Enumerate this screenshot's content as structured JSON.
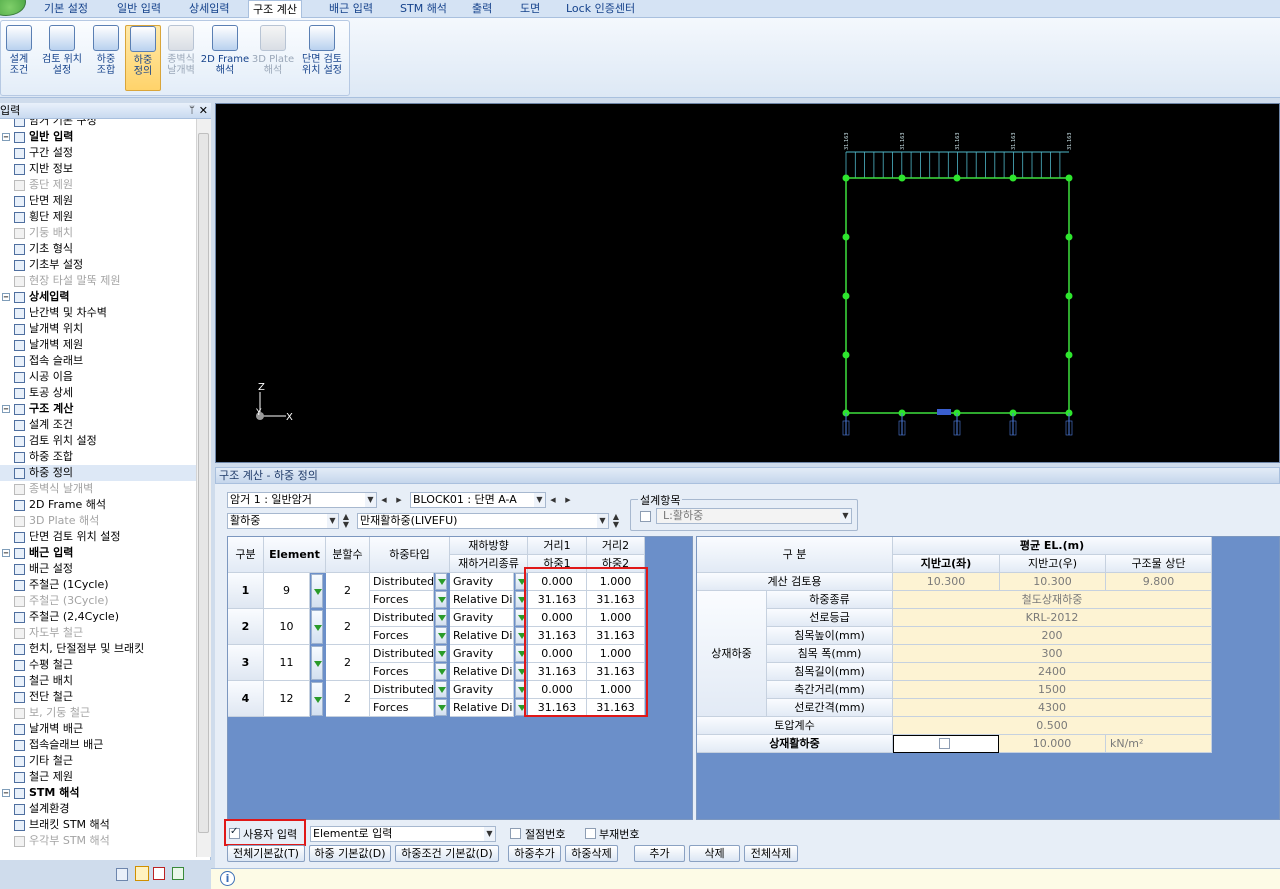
{
  "ribbon": {
    "tabs": [
      "기본 설정",
      "일반 입력",
      "상세입력",
      "구조 계산",
      "배근 입력",
      "STM 해석",
      "출력",
      "도면",
      "Lock 인증센터"
    ],
    "active_tab": "구조 계산",
    "buttons": [
      {
        "l1": "설계",
        "l2": "조건",
        "icon": "design-condition-icon",
        "state": "normal"
      },
      {
        "l1": "검토 위치",
        "l2": "설정",
        "icon": "review-location-icon",
        "state": "normal"
      },
      {
        "l1": "하중",
        "l2": "조합",
        "icon": "load-combination-icon",
        "state": "normal"
      },
      {
        "l1": "하중",
        "l2": "정의",
        "icon": "load-definition-icon",
        "state": "selected"
      },
      {
        "l1": "종벽식",
        "l2": "날개벽",
        "icon": "wing-wall-icon",
        "state": "disabled"
      },
      {
        "l1": "2D Frame",
        "l2": "해석",
        "icon": "frame-2d-icon",
        "state": "normal"
      },
      {
        "l1": "3D Plate",
        "l2": "해석",
        "icon": "plate-3d-icon",
        "state": "disabled"
      },
      {
        "l1": "단면 검토",
        "l2": "위치 설정",
        "icon": "section-review-icon",
        "state": "normal"
      }
    ]
  },
  "left_panel": {
    "title": "입력",
    "pin": "ᛘ",
    "close": "✕",
    "tree": [
      {
        "label": "암거 기본 구성",
        "type": "item",
        "state": "normal"
      },
      {
        "label": "일반 입력",
        "type": "group"
      },
      {
        "label": "구간 설정",
        "type": "item",
        "state": "normal"
      },
      {
        "label": "지반 정보",
        "type": "item",
        "state": "normal"
      },
      {
        "label": "종단 제원",
        "type": "item",
        "state": "disabled"
      },
      {
        "label": "단면 제원",
        "type": "item",
        "state": "normal"
      },
      {
        "label": "횡단 제원",
        "type": "item",
        "state": "normal"
      },
      {
        "label": "기둥 배치",
        "type": "item",
        "state": "disabled"
      },
      {
        "label": "기초 형식",
        "type": "item",
        "state": "normal"
      },
      {
        "label": "기초부 설정",
        "type": "item",
        "state": "normal"
      },
      {
        "label": "현장 타설 말뚝 제원",
        "type": "item",
        "state": "disabled"
      },
      {
        "label": "상세입력",
        "type": "group"
      },
      {
        "label": "난간벽 및 차수벽",
        "type": "item",
        "state": "normal"
      },
      {
        "label": "날개벽 위치",
        "type": "item",
        "state": "normal"
      },
      {
        "label": "날개벽 제원",
        "type": "item",
        "state": "normal"
      },
      {
        "label": "접속 슬래브",
        "type": "item",
        "state": "normal"
      },
      {
        "label": "시공 이음",
        "type": "item",
        "state": "normal"
      },
      {
        "label": "토공 상세",
        "type": "item",
        "state": "normal"
      },
      {
        "label": "구조 계산",
        "type": "group"
      },
      {
        "label": "설계 조건",
        "type": "item",
        "state": "normal"
      },
      {
        "label": "검토 위치 설정",
        "type": "item",
        "state": "normal"
      },
      {
        "label": "하중 조합",
        "type": "item",
        "state": "normal"
      },
      {
        "label": "하중 정의",
        "type": "item",
        "state": "selected"
      },
      {
        "label": "종벽식 날개벽",
        "type": "item",
        "state": "disabled"
      },
      {
        "label": "2D Frame 해석",
        "type": "item",
        "state": "normal"
      },
      {
        "label": "3D Plate 해석",
        "type": "item",
        "state": "disabled"
      },
      {
        "label": "단면 검토 위치 설정",
        "type": "item",
        "state": "normal"
      },
      {
        "label": "배근 입력",
        "type": "group"
      },
      {
        "label": "배근 설정",
        "type": "item",
        "state": "normal"
      },
      {
        "label": "주철근 (1Cycle)",
        "type": "item",
        "state": "normal"
      },
      {
        "label": "주철근 (3Cycle)",
        "type": "item",
        "state": "disabled"
      },
      {
        "label": "주철근 (2,4Cycle)",
        "type": "item",
        "state": "normal"
      },
      {
        "label": "자도부 철근",
        "type": "item",
        "state": "disabled"
      },
      {
        "label": "헌치, 단절점부 및 브래킷",
        "type": "item",
        "state": "normal"
      },
      {
        "label": "수평 철근",
        "type": "item",
        "state": "normal"
      },
      {
        "label": "철근 배치",
        "type": "item",
        "state": "normal"
      },
      {
        "label": "전단 철근",
        "type": "item",
        "state": "normal"
      },
      {
        "label": "보, 기둥 철근",
        "type": "item",
        "state": "disabled"
      },
      {
        "label": "날개벽 배근",
        "type": "item",
        "state": "normal"
      },
      {
        "label": "접속슬래브 배근",
        "type": "item",
        "state": "normal"
      },
      {
        "label": "기타 철근",
        "type": "item",
        "state": "normal"
      },
      {
        "label": "철근 제원",
        "type": "item",
        "state": "normal"
      },
      {
        "label": "STM 해석",
        "type": "group"
      },
      {
        "label": "설계환경",
        "type": "item",
        "state": "normal"
      },
      {
        "label": "브래킷 STM 해석",
        "type": "item",
        "state": "normal"
      },
      {
        "label": "우각부 STM 해석",
        "type": "item",
        "state": "disabled"
      }
    ]
  },
  "viewport": {
    "top_labels": [
      "31.163",
      "31.163",
      "31.163",
      "31.163",
      "31.163"
    ],
    "axis": {
      "z": "Z",
      "y": "Y",
      "x": "X"
    }
  },
  "dialog": {
    "title": "구조 계산 - 하중 정의",
    "culvert_select": "암거 1 : 일반암거",
    "block_select": "BLOCK01 : 단면 A-A",
    "load_type_select": "활하중",
    "load_case_select": "만재활하중(LIVEFU)",
    "design_item_label": "설계항목",
    "design_item_value": "L:활하중",
    "left_table": {
      "headers": {
        "gubun": "구분",
        "element": "Element",
        "divisions": "분할수",
        "load_type": "하중타입",
        "dir1": "재하방향",
        "dir2": "재하거리종류",
        "d1a": "거리1",
        "d1b": "하중1",
        "d2a": "거리2",
        "d2b": "하중2"
      },
      "rows": [
        {
          "no": "1",
          "element": "9",
          "div": "2",
          "type1": "Distributed",
          "type2": "Forces",
          "dir1": "Gravity",
          "dir2": "Relative Dist",
          "dist1": "0.000",
          "dist2": "1.000",
          "load1": "31.163",
          "load2": "31.163"
        },
        {
          "no": "2",
          "element": "10",
          "div": "2",
          "type1": "Distributed",
          "type2": "Forces",
          "dir1": "Gravity",
          "dir2": "Relative Dist",
          "dist1": "0.000",
          "dist2": "1.000",
          "load1": "31.163",
          "load2": "31.163"
        },
        {
          "no": "3",
          "element": "11",
          "div": "2",
          "type1": "Distributed",
          "type2": "Forces",
          "dir1": "Gravity",
          "dir2": "Relative Dist",
          "dist1": "0.000",
          "dist2": "1.000",
          "load1": "31.163",
          "load2": "31.163"
        },
        {
          "no": "4",
          "element": "12",
          "div": "2",
          "type1": "Distributed",
          "type2": "Forces",
          "dir1": "Gravity",
          "dir2": "Relative Dist",
          "dist1": "0.000",
          "dist2": "1.000",
          "load1": "31.163",
          "load2": "31.163"
        }
      ]
    },
    "right_table": {
      "gubun": "구 분",
      "avg_el": "평균 EL.(m)",
      "cols": [
        "지반고(좌)",
        "지반고(우)",
        "구조물 상단"
      ],
      "calc_label": "계산 검토용",
      "calc_vals": [
        "10.300",
        "10.300",
        "9.800"
      ],
      "group_label": "상재하중",
      "items": [
        {
          "label": "하중종류",
          "value": "철도상재하중"
        },
        {
          "label": "선로등급",
          "value": "KRL-2012"
        },
        {
          "label": "침목높이(mm)",
          "value": "200"
        },
        {
          "label": "침목 폭(mm)",
          "value": "300"
        },
        {
          "label": "침목길이(mm)",
          "value": "2400"
        },
        {
          "label": "축간거리(mm)",
          "value": "1500"
        },
        {
          "label": "선로간격(mm)",
          "value": "4300"
        }
      ],
      "soil_label": "토압계수",
      "soil_value": "0.500",
      "live_label": "상재활하중",
      "live_value": "10.000",
      "live_unit": "kN/m²"
    },
    "bottom": {
      "user_input": "사용자 입력",
      "input_mode": "Element로 입력",
      "node_no": "절점번호",
      "member_no": "부재번호",
      "buttons": [
        "전체기본값(T)",
        "하중 기본값(D)",
        "하중조건 기본값(D)",
        "하중추가",
        "하중삭제",
        "추가",
        "삭제",
        "전체삭제"
      ]
    }
  },
  "status": {
    "icon": "info-icon"
  }
}
